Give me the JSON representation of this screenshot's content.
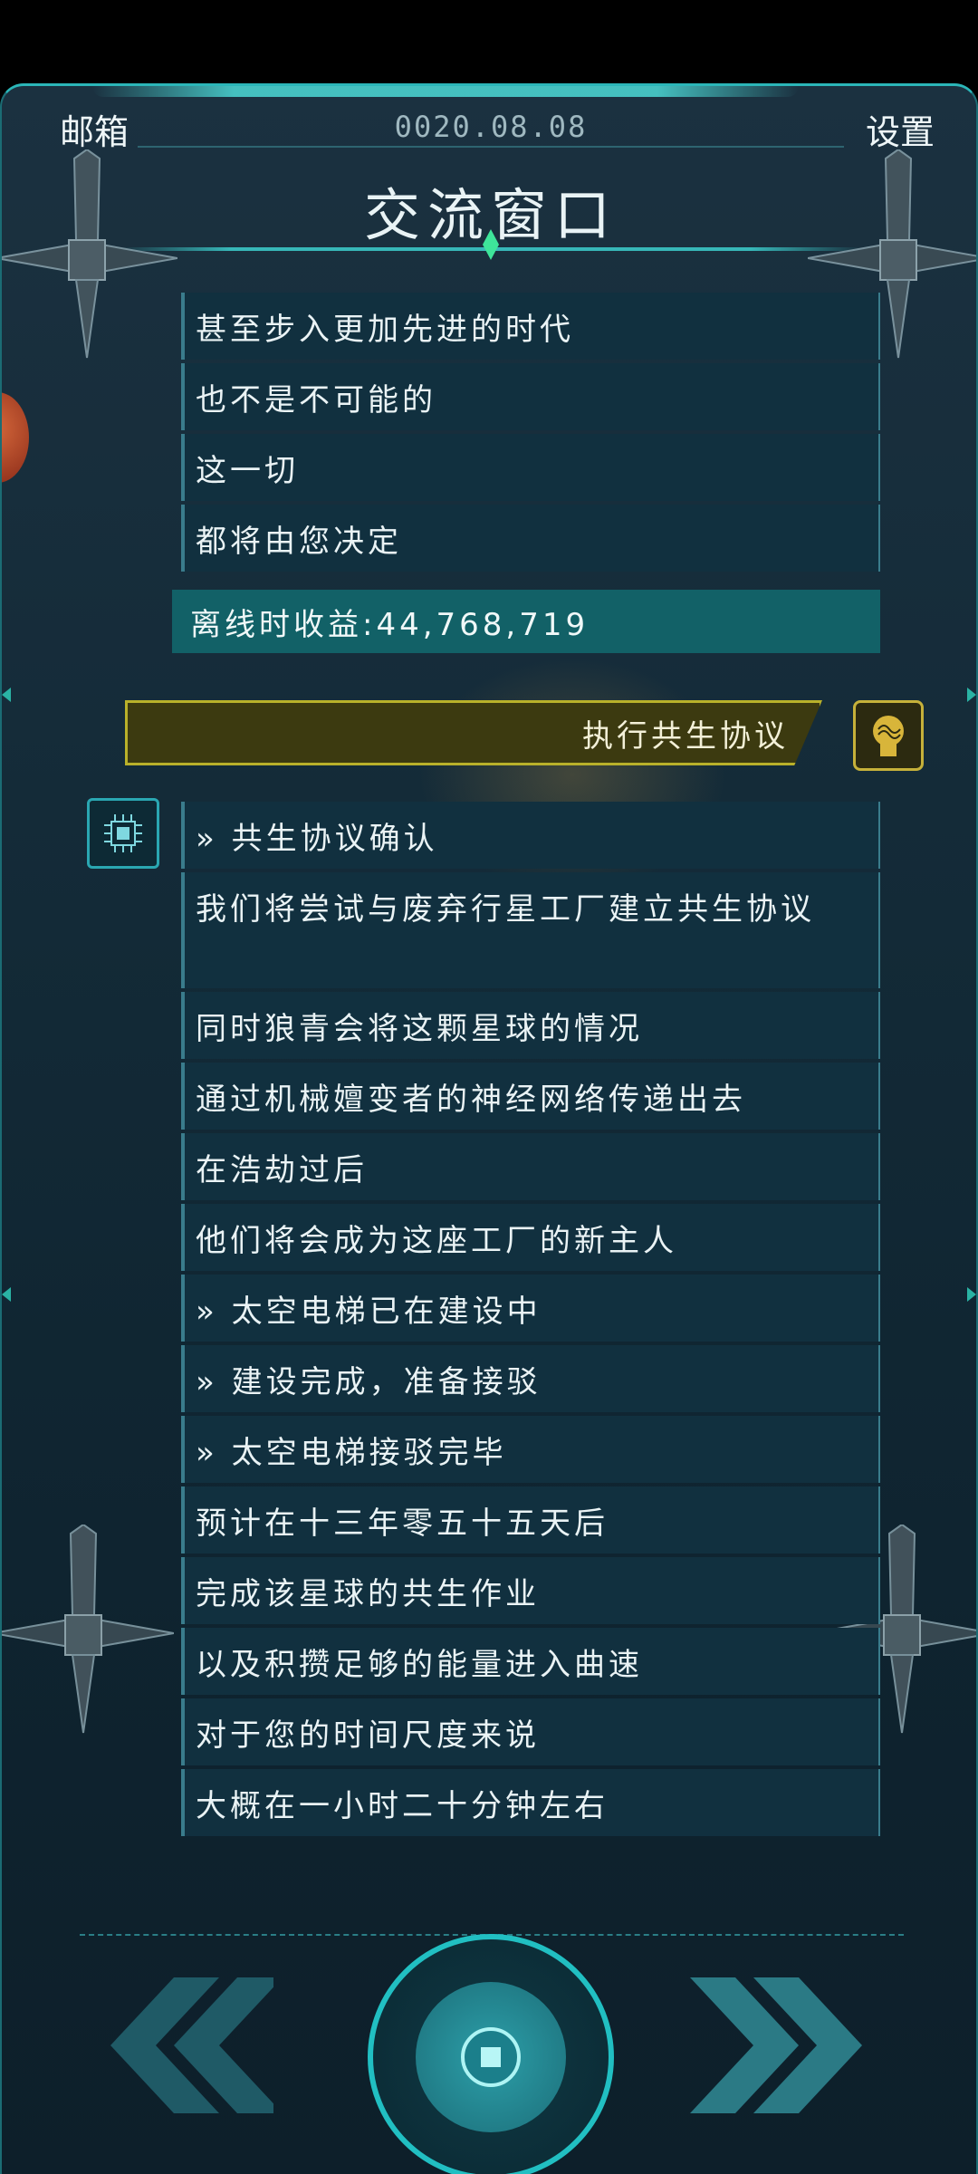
{
  "header": {
    "mail_label": "邮箱",
    "date": "0020.08.08",
    "settings_label": "设置",
    "title": "交流窗口"
  },
  "messages_top": [
    "甚至步入更加先进的时代",
    "也不是不可能的",
    "这一切",
    "都将由您决定"
  ],
  "offline_income": "离线时收益:44,768,719",
  "action": {
    "execute_label": "执行共生协议",
    "brain_icon": "brain-icon",
    "ai_icon": "ai-chip-icon"
  },
  "messages_bottom": [
    "» 共生协议确认",
    "我们将尝试与废弃行星工厂建立共生协议",
    "同时狼青会将这颗星球的情况",
    "通过机械嬗变者的神经网络传递出去",
    "在浩劫过后",
    "他们将会成为这座工厂的新主人",
    "» 太空电梯已在建设中",
    "» 建设完成，准备接驳",
    "» 太空电梯接驳完毕",
    "预计在十三年零五十五天后",
    "完成该星球的共生作业",
    "以及积攒足够的能量进入曲速",
    "对于您的时间尺度来说",
    "大概在一小时二十分钟左右"
  ],
  "colors": {
    "accent": "#21bfc2",
    "action_bar": "#3c3a10",
    "action_border": "#b9b12a",
    "income_bg": "#126167"
  }
}
